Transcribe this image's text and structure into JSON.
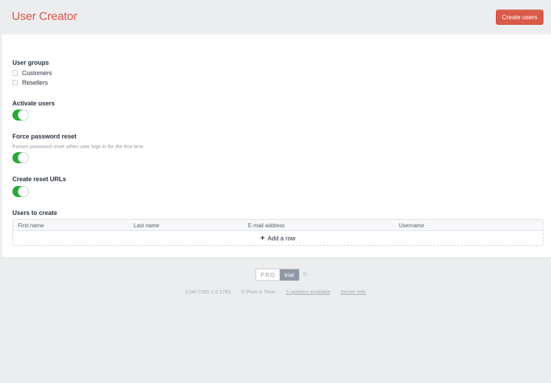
{
  "header": {
    "title": "User Creator",
    "create_button": "Create users"
  },
  "user_groups": {
    "heading": "User groups",
    "options": [
      {
        "label": "Customers",
        "checked": false
      },
      {
        "label": "Resellers",
        "checked": false
      }
    ]
  },
  "activate_users": {
    "heading": "Activate users",
    "enabled": true
  },
  "force_password_reset": {
    "heading": "Force password reset",
    "instructions": "Forces password reset when user logs in for the first time.",
    "enabled": true
  },
  "create_reset_urls": {
    "heading": "Create reset URLs",
    "enabled": true
  },
  "users_table": {
    "heading": "Users to create",
    "columns": [
      "First name",
      "Last name",
      "E-mail address",
      "Username"
    ],
    "add_row_label": "Add a row"
  },
  "edition_badge": {
    "edition": "PRO",
    "status": "trial"
  },
  "footer": {
    "version": "Craft CMS 2.6.2783",
    "copyright": "© Pixel & Tonic",
    "updates": "3 updates available",
    "server_info": "Server Info"
  },
  "colors": {
    "accent": "#da5a47",
    "toggle_on": "#27ab35"
  }
}
